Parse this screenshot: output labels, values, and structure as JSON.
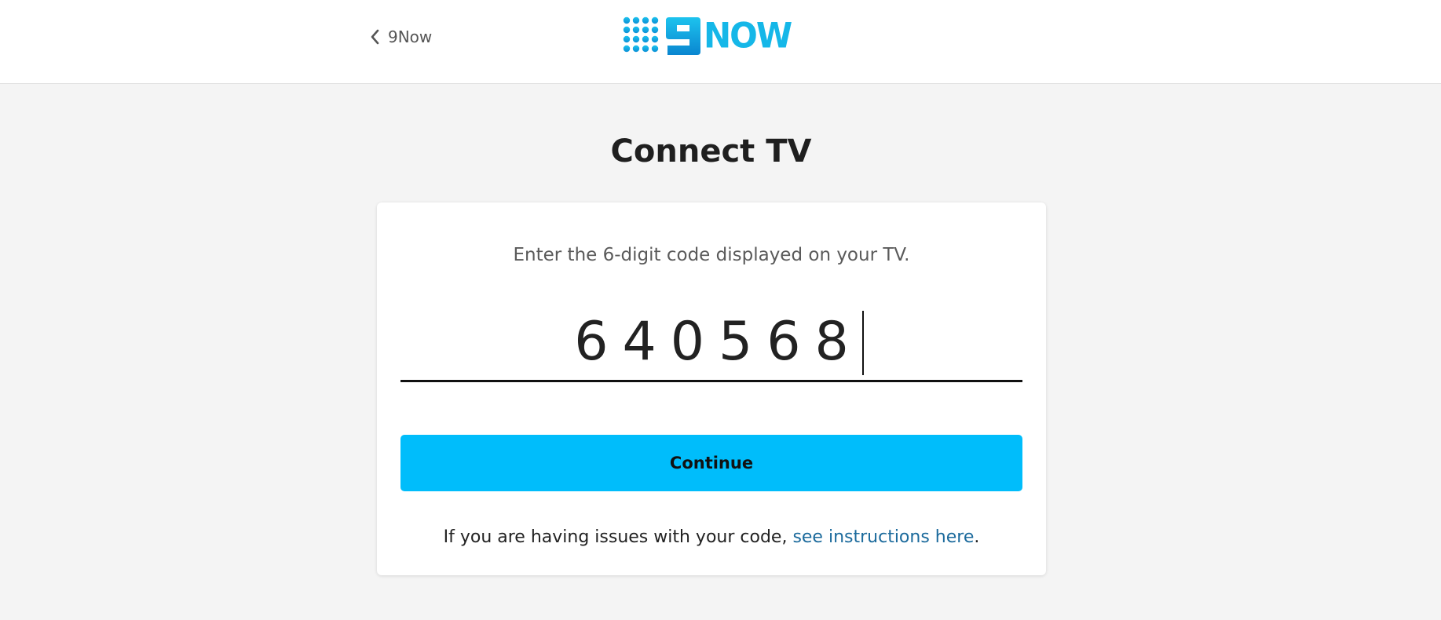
{
  "header": {
    "back_label": "9Now",
    "logo_text": "NOW",
    "logo_color": "#15b7e8"
  },
  "page": {
    "title": "Connect TV"
  },
  "card": {
    "instruction": "Enter the 6-digit code displayed on your TV.",
    "code_value": "640568",
    "continue_label": "Continue",
    "help_prefix": "If you are having issues with your code, ",
    "help_link": "see instructions here",
    "help_suffix": "."
  },
  "colors": {
    "background": "#f4f4f4",
    "accent_button": "#00bdfb",
    "link": "#1b6a9c"
  }
}
